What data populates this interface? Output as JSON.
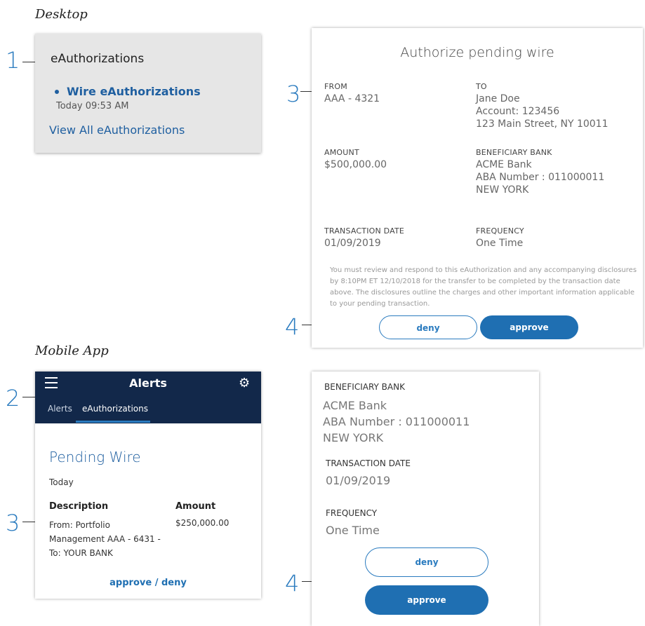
{
  "sections": {
    "desktop": "Desktop",
    "mobile": "Mobile App"
  },
  "callouts": {
    "c1": "1",
    "c2": "2",
    "c3a": "3",
    "c3b": "3",
    "c4a": "4",
    "c4b": "4"
  },
  "desktop_card": {
    "heading": "eAuthorizations",
    "wire_link": "Wire eAuthorizations",
    "timestamp": "Today 09:53 AM",
    "view_all": "View All eAuthorizations"
  },
  "wire_card": {
    "title": "Authorize pending wire",
    "from_label": "FROM",
    "from_value": "AAA - 4321",
    "to_label": "TO",
    "to_name": "Jane Doe",
    "to_account": "Account: 123456",
    "to_address": "123 Main Street, NY 10011",
    "amount_label": "AMOUNT",
    "amount_value": "$500,000.00",
    "bank_label": "BENEFICIARY BANK",
    "bank_name": "ACME Bank",
    "bank_aba": "ABA Number : 011000011",
    "bank_city": "NEW YORK",
    "date_label": "TRANSACTION DATE",
    "date_value": "01/09/2019",
    "freq_label": "FREQUENCY",
    "freq_value": "One Time",
    "disclaimer": "You must review and respond to this eAuthorization and any accompanying disclosures by 8:10PM ET 12/10/2018 for the transfer to be completed by the transaction date above. The disclosures outline the charges and other important information applicable to your pending transaction.",
    "deny": "deny",
    "approve": "approve"
  },
  "mobile_alerts": {
    "title": "Alerts",
    "tab_alerts": "Alerts",
    "tab_eauth": "eAuthorizations",
    "pending": "Pending Wire",
    "today": "Today",
    "desc_header": "Description",
    "amount_header": "Amount",
    "description": "From: Portfolio Management AAA - 6431 - To: YOUR BANK",
    "amount": "$250,000.00",
    "action": "approve / deny"
  },
  "mobile_detail": {
    "bank_label": "BENEFICIARY BANK",
    "bank_name": "ACME Bank",
    "bank_aba": "ABA Number : 011000011",
    "bank_city": "NEW YORK",
    "date_label": "TRANSACTION DATE",
    "date_value": "01/09/2019",
    "freq_label": "FREQUENCY",
    "freq_value": "One Time",
    "deny": "deny",
    "approve": "approve"
  },
  "colors": {
    "accent": "#1f6fb2",
    "navy": "#12284a",
    "callout": "#2a7bbf"
  }
}
